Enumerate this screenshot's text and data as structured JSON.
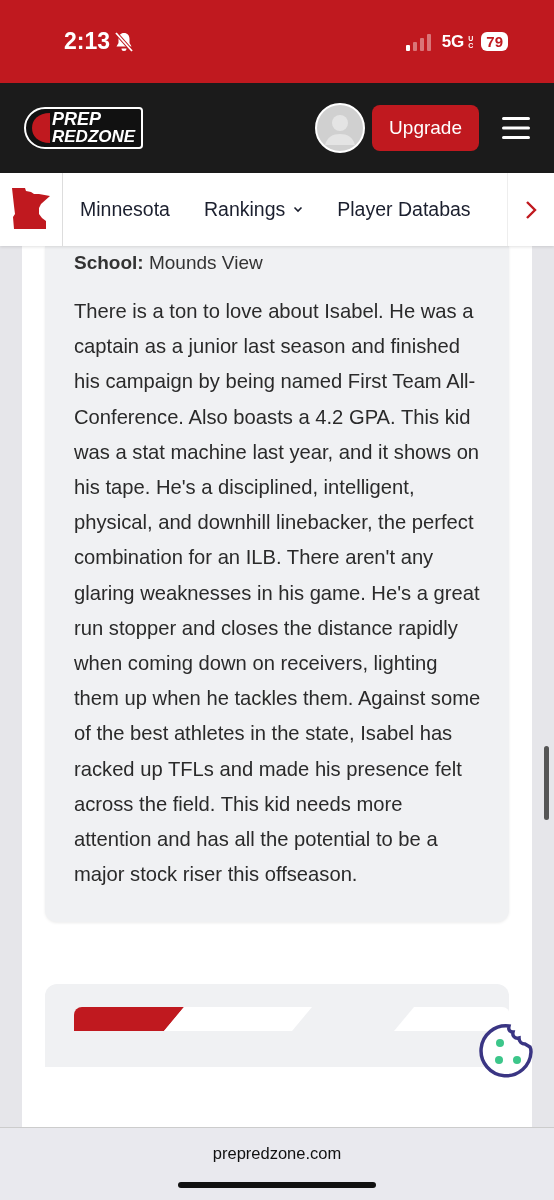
{
  "status_bar": {
    "time": "2:13",
    "network": "5G",
    "network_sub": "UC",
    "battery": "79",
    "silent": true
  },
  "header": {
    "logo_top": "PREP",
    "logo_bottom": "REDZONE",
    "upgrade": "Upgrade"
  },
  "nav": {
    "items": [
      {
        "label": "Minnesota",
        "dropdown": false
      },
      {
        "label": "Rankings",
        "dropdown": true
      },
      {
        "label": "Player Databas",
        "dropdown": false
      }
    ]
  },
  "card": {
    "school": "**School:** Mounds View",
    "text": "There is a ton to love about Isabel. He was a captain as a junior last season and finished his campaign by being named First Team All-Conference. Also boasts a 4.2 GPA. This kid was a stat machine last year, and it shows on his tape. He's a disciplined, intelligent, physical, and downhill linebacker, the perfect combination for an ILB. There aren't any glaring weaknesses in his game. He's a great run stopper and closes the distance rapidly when coming down on receivers, lighting them up when he tackles them. Against some of the best athletes in the state, Isabel has racked up TFLs and made his presence felt across the field. This kid needs more attention and has all the potential to be a major stock riser this offseason."
  },
  "url_bar": {
    "url": "prepredzone.com"
  }
}
